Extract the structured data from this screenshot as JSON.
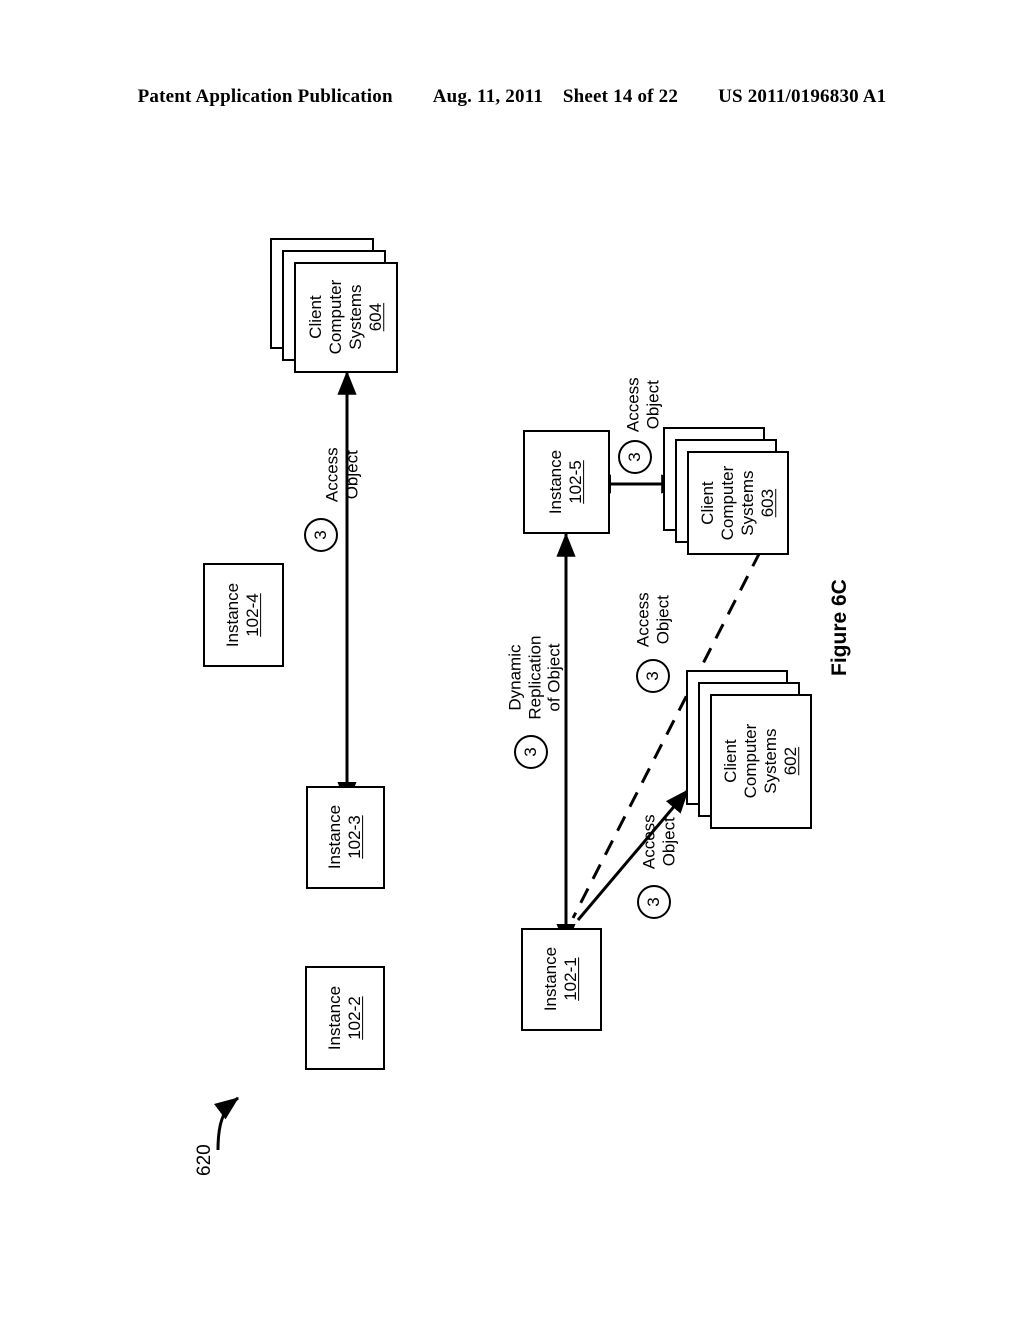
{
  "header": {
    "left": "Patent Application Publication",
    "date": "Aug. 11, 2011",
    "sheet": "Sheet 14 of 22",
    "pub_number": "US 2011/0196830 A1"
  },
  "figure": {
    "caption": "Figure 6C",
    "reference_numeral": "620"
  },
  "nodes": {
    "instance_102_4": {
      "title": "Instance",
      "number": "102-4"
    },
    "instance_102_3": {
      "title": "Instance",
      "number": "102-3"
    },
    "instance_102_2": {
      "title": "Instance",
      "number": "102-2"
    },
    "instance_102_5": {
      "title": "Instance",
      "number": "102-5"
    },
    "instance_102_1": {
      "title": "Instance",
      "number": "102-1"
    },
    "client_systems_604": {
      "line1": "Client",
      "line2": "Computer",
      "line3": "Systems",
      "number": "604"
    },
    "client_systems_603": {
      "line1": "Client",
      "line2": "Computer",
      "line3": "Systems",
      "number": "603"
    },
    "client_systems_602": {
      "line1": "Client",
      "line2": "Computer",
      "line3": "Systems",
      "number": "602"
    }
  },
  "edge_labels": {
    "access_object_604": {
      "line1": "Access",
      "line2": "Object",
      "step": "3"
    },
    "access_object_603": {
      "line1": "Access",
      "line2": "Object",
      "step": "3"
    },
    "access_object_602_dashed": {
      "line1": "Access",
      "line2": "Object",
      "step": "3"
    },
    "access_object_602_solid": {
      "line1": "Access",
      "line2": "Object",
      "step": "3"
    },
    "dynamic_replication": {
      "line1": "Dynamic",
      "line2": "Replication",
      "line3": "of Object",
      "step": "3"
    }
  },
  "colors": {
    "ink": "#000000",
    "paper": "#ffffff"
  }
}
